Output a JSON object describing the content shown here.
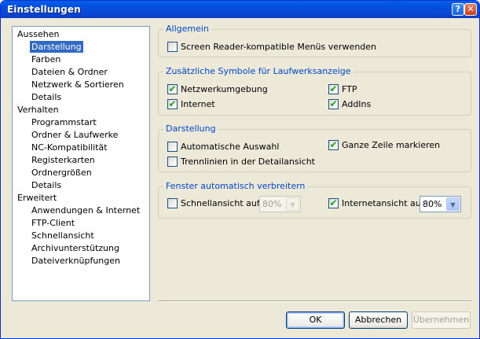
{
  "window": {
    "title": "Einstellungen",
    "help_icon": "help-icon",
    "close_icon": "close-icon"
  },
  "tree": {
    "items": [
      {
        "label": "Aussehen",
        "level": 0,
        "selected": false
      },
      {
        "label": "Darstellung",
        "level": 1,
        "selected": true
      },
      {
        "label": "Farben",
        "level": 1,
        "selected": false
      },
      {
        "label": "Dateien & Ordner",
        "level": 1,
        "selected": false
      },
      {
        "label": "Netzwerk & Sortieren",
        "level": 1,
        "selected": false
      },
      {
        "label": "Details",
        "level": 1,
        "selected": false
      },
      {
        "label": "Verhalten",
        "level": 0,
        "selected": false
      },
      {
        "label": "Programmstart",
        "level": 1,
        "selected": false
      },
      {
        "label": "Ordner & Laufwerke",
        "level": 1,
        "selected": false
      },
      {
        "label": "NC-Kompatibilität",
        "level": 1,
        "selected": false
      },
      {
        "label": "Registerkarten",
        "level": 1,
        "selected": false
      },
      {
        "label": "Ordnergrößen",
        "level": 1,
        "selected": false
      },
      {
        "label": "Details",
        "level": 1,
        "selected": false
      },
      {
        "label": "Erweitert",
        "level": 0,
        "selected": false
      },
      {
        "label": "Anwendungen & Internet",
        "level": 1,
        "selected": false
      },
      {
        "label": "FTP-Client",
        "level": 1,
        "selected": false
      },
      {
        "label": "Schnellansicht",
        "level": 1,
        "selected": false
      },
      {
        "label": "Archivunterstützung",
        "level": 1,
        "selected": false
      },
      {
        "label": "Dateiverknüpfungen",
        "level": 1,
        "selected": false
      }
    ]
  },
  "groups": {
    "allgemein": {
      "title": "Allgemein",
      "options": [
        {
          "label": "Screen Reader-kompatible Menüs verwenden",
          "checked": false
        }
      ]
    },
    "symbole": {
      "title": "Zusätzliche Symbole für Laufwerksanzeige",
      "options": [
        {
          "label": "Netzwerkumgebung",
          "checked": true
        },
        {
          "label": "FTP",
          "checked": true
        },
        {
          "label": "Internet",
          "checked": true
        },
        {
          "label": "AddIns",
          "checked": true
        }
      ]
    },
    "darstellung": {
      "title": "Darstellung",
      "options": [
        {
          "label": "Automatische Auswahl",
          "checked": false
        },
        {
          "label": "Ganze Zeile markieren",
          "checked": true
        },
        {
          "label": "Trennlinien in der Detailansicht",
          "checked": false
        }
      ]
    },
    "fenster": {
      "title": "Fenster automatisch verbreitern",
      "options": [
        {
          "label": "Schnellansicht auf",
          "checked": false,
          "value": "80%",
          "enabled": false
        },
        {
          "label": "Internetansicht auf",
          "checked": true,
          "value": "80%",
          "enabled": true
        }
      ]
    }
  },
  "buttons": {
    "ok": "OK",
    "cancel": "Abbrechen",
    "apply": "Übernehmen"
  },
  "colors": {
    "title_bar": "#0054e3",
    "group_title": "#0046d5",
    "selection": "#316ac5",
    "check": "#21a121"
  }
}
